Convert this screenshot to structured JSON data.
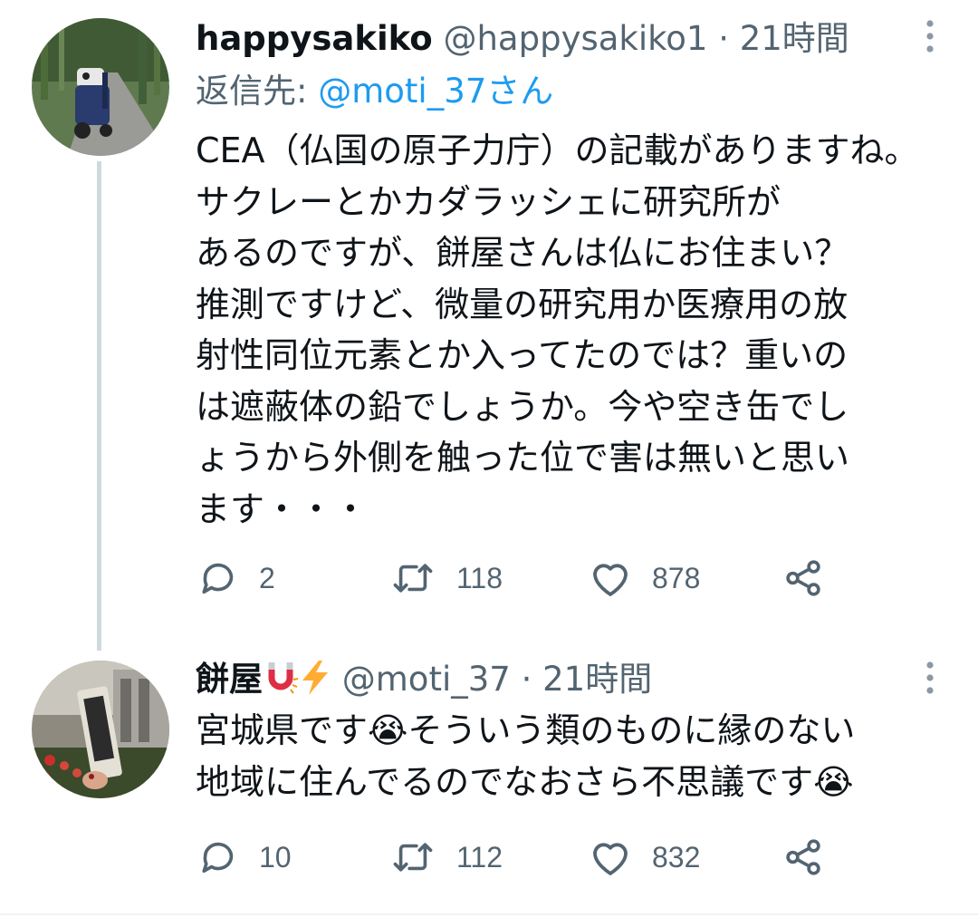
{
  "tweets": [
    {
      "display_name": "happysakiko",
      "handle": "@happysakiko1",
      "separator": "·",
      "time": "21時間",
      "reply_to_label": "返信先: ",
      "reply_to_mention": "@moti_37さん",
      "body": "CEA（仏国の原子力庁）の記載がありますね。サクレーとかカダラッシェに研究所があるのですが、餅屋さんは仏にお住まい？推測ですけど、微量の研究用か医療用の放射性同位元素とか入ってたのでは？重いのは遮蔽体の鉛でしょうか。今や空き缶でしょうから外側を触った位で害は無いと思います・・・",
      "body_lines": [
        "CEA（仏国の原子力庁）の記載がありますね。",
        "サクレーとかカダラッシェに研究所が",
        "あるのですが、餅屋さんは仏にお住まい？",
        "推測ですけど、微量の研究用か医療用の放",
        "射性同位元素とか入ってたのでは？重いの",
        "は遮蔽体の鉛でしょうか。今や空き缶でし",
        "ょうから外側を触った位で害は無いと思い",
        "ます・・・"
      ],
      "replies": "2",
      "retweets": "118",
      "likes": "878"
    },
    {
      "display_name": "餅屋",
      "name_emojis": [
        "magnet-emoji",
        "lightning-emoji"
      ],
      "handle": "@moti_37",
      "separator": "·",
      "time": "21時間",
      "body": "宮城県です😭そういう類のものに縁のない地域に住んでるのでなおさら不思議です😭",
      "body_lines": [
        "宮城県です😭そういう類のものに縁のない",
        "地域に住んでるのでなおさら不思議です😭"
      ],
      "replies": "10",
      "retweets": "112",
      "likes": "832"
    }
  ],
  "colors": {
    "text": "#0f1419",
    "secondary": "#536471",
    "link": "#1d9bf0",
    "thread_line": "#cfd9de",
    "icon": "#536471"
  },
  "icons": {
    "reply": "speech-bubble-icon",
    "retweet": "retweet-arrows-icon",
    "like": "heart-icon",
    "share": "share-nodes-icon",
    "more": "vertical-dots-icon"
  }
}
